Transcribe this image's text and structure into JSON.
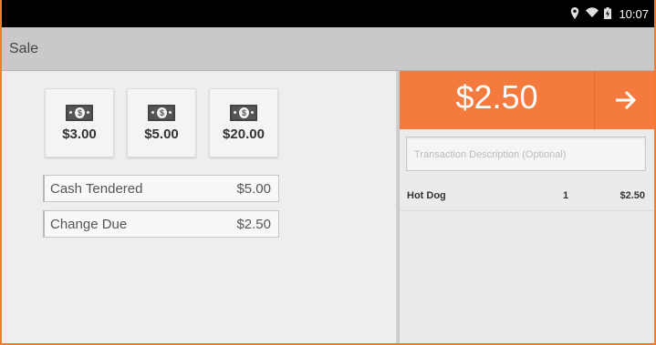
{
  "status_bar": {
    "time": "10:07",
    "icons": [
      "location-icon",
      "wifi-icon",
      "battery-icon"
    ]
  },
  "action_bar": {
    "title": "Sale"
  },
  "cash_buttons": [
    {
      "label": "$3.00",
      "icon": "cash-bill-icon"
    },
    {
      "label": "$5.00",
      "icon": "cash-bill-icon"
    },
    {
      "label": "$20.00",
      "icon": "cash-bill-icon"
    }
  ],
  "cash_tendered": {
    "label": "Cash Tendered",
    "value": "$5.00"
  },
  "change_due": {
    "label": "Change Due",
    "value": "$2.50"
  },
  "order": {
    "total": "$2.50",
    "charge_icon": "arrow-right-icon",
    "description_placeholder": "Transaction Description (Optional)",
    "items": [
      {
        "name": "Hot Dog",
        "quantity": "1",
        "price": "$2.50"
      }
    ]
  },
  "colors": {
    "accent": "#f47a3d",
    "status_bar": "#000000",
    "action_bar": "#c9c9c9"
  }
}
